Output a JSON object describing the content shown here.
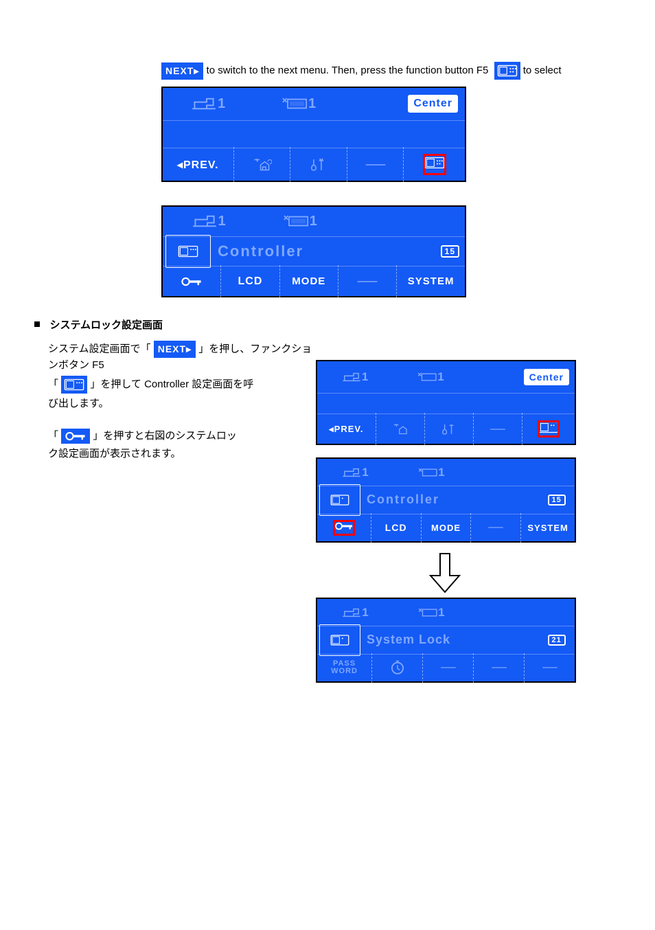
{
  "line1": {
    "next_label": "NEXT▸",
    "text_after": " to switch to the next menu. Then, press the function button F5"
  },
  "line2": "to select",
  "lcd1": {
    "row1": {
      "reader1": "1",
      "printer1": "1",
      "center": "Center"
    },
    "row3": {
      "prev": "◂PREV."
    }
  },
  "lcd2": {
    "row1": {
      "reader1": "1",
      "printer1": "1"
    },
    "row2": {
      "title": "Controller",
      "num": "15"
    },
    "row3": {
      "lcd": "LCD",
      "mode": "MODE",
      "system": "SYSTEM"
    }
  },
  "bullet_heading": "システムロック設定画面",
  "para1": {
    "line1_a": "システム設定画面で「",
    "line1_b": "」を押し、ファンクションボタン F5",
    "line2_a": "「",
    "line2_b": "」を押して Controller 設定画面を呼",
    "line3": "び出します。",
    "line4_a": "「",
    "line4_b": "」を押すと右図のシステムロッ",
    "line5": "ク設定画面が表示されます。"
  },
  "lcdR1": {
    "row1": {
      "reader1": "1",
      "printer1": "1",
      "center": "Center"
    },
    "row3": {
      "prev": "◂PREV."
    }
  },
  "lcdR2": {
    "row1": {
      "reader1": "1",
      "printer1": "1"
    },
    "row2": {
      "title": "Controller",
      "num": "15"
    },
    "row3": {
      "lcd": "LCD",
      "mode": "MODE",
      "system": "SYSTEM"
    }
  },
  "lcdR3": {
    "row1": {
      "reader1": "1",
      "printer1": "1"
    },
    "row2": {
      "title": "System Lock",
      "num": "21"
    },
    "row3": {
      "passw": "PASS\nWORD"
    }
  }
}
